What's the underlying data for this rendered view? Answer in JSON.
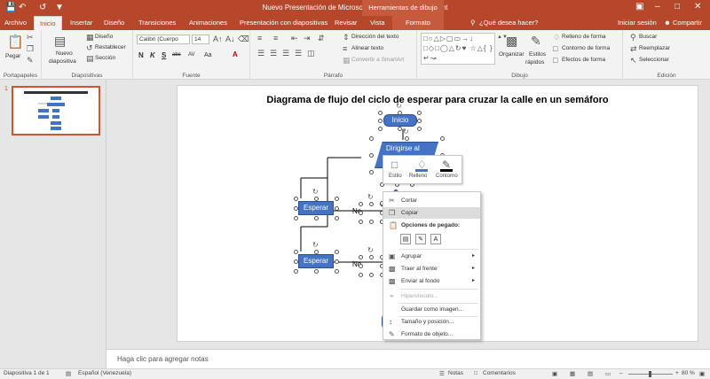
{
  "titlebar": {
    "title": "Nuevo Presentación de Microsoft PowerPoint - PowerPoint",
    "context_group": "Herramientas de dibujo",
    "save_icon": "save-icon",
    "undo_icon": "undo-icon",
    "redo_icon": "redo-icon",
    "customize_icon": "customize-icon"
  },
  "tabs": {
    "items": [
      "Archivo",
      "Inicio",
      "Insertar",
      "Diseño",
      "Transiciones",
      "Animaciones",
      "Presentación con diapositivas",
      "Revisar",
      "Vista",
      "Formato"
    ],
    "active": "Inicio",
    "tell_me": "¿Qué desea hacer?",
    "sign_in": "Iniciar sesión",
    "share": "Compartir"
  },
  "ribbon": {
    "portapapeles": {
      "label": "Portapapeles",
      "paste": "Pegar"
    },
    "diapositivas": {
      "label": "Diapositivas",
      "new_slide_1": "Nuevo",
      "new_slide_2": "diapositiva",
      "layout": "Diseño",
      "reset": "Restablecer",
      "section": "Sección"
    },
    "fuente": {
      "label": "Fuente",
      "font_name": "Calibri (Cuerpo",
      "font_size": "14",
      "bold": "N",
      "italic": "K",
      "underline": "S",
      "strike": "abc",
      "spacing": "AV",
      "case": "Aa"
    },
    "parrafo": {
      "label": "Párrafo",
      "text_direction": "Dirección del texto",
      "align_text": "Alinear texto",
      "smartart": "Convertir a SmartArt"
    },
    "dibujo": {
      "label": "Dibujo",
      "arrange": "Organizar",
      "quick_styles_1": "Estilos",
      "quick_styles_2": "rápidos",
      "fill": "Relleno de forma",
      "outline": "Contorno de forma",
      "effects": "Efectos de forma"
    },
    "edicion": {
      "label": "Edición",
      "find": "Buscar",
      "replace": "Reemplazar",
      "select": "Seleccionar"
    }
  },
  "thumb": {
    "number": "1"
  },
  "slide": {
    "title": "Diagrama de flujo del ciclo de  esperar para cruzar la calle en un semáforo",
    "shapes": {
      "inicio": "Inicio",
      "dirigirse": "Dirigirse al",
      "esperar1": "Esperar",
      "esperar2": "Esperar",
      "no1": "No",
      "no2": "No"
    }
  },
  "mini_toolbar": {
    "style": "Estilo",
    "fill": "Relleno",
    "outline": "Contorno"
  },
  "context_menu": {
    "cut": "Cortar",
    "copy": "Copiar",
    "paste_options": "Opciones de pegado:",
    "group": "Agrupar",
    "bring_front": "Traer al frente",
    "send_back": "Enviar al fondo",
    "hyperlink": "Hipervínculo...",
    "save_image": "Guardar como imagen...",
    "size_position": "Tamaño y posición...",
    "format_object": "Formato de objeto..."
  },
  "notes": {
    "placeholder": "Haga clic para agregar notas"
  },
  "status": {
    "slide_count": "Diapositiva 1 de 1",
    "language": "Español (Venezuela)",
    "notes": "Notas",
    "comments": "Comentarios",
    "zoom": "80 %"
  },
  "colors": {
    "accent": "#b7472a",
    "shape_fill": "#4472c4"
  }
}
